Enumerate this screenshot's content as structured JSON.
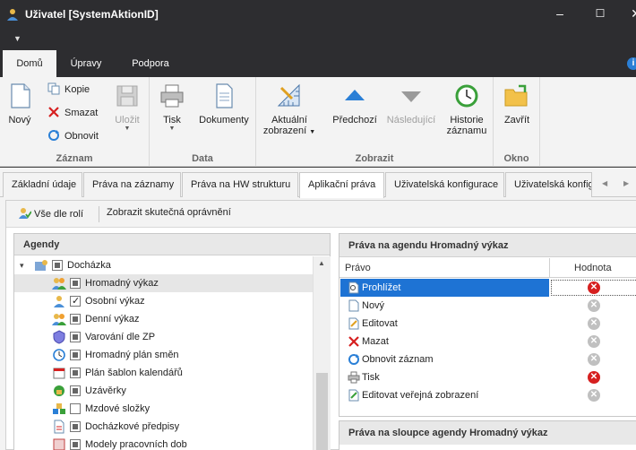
{
  "window": {
    "title": "Uživatel [SystemAktionID]"
  },
  "ribbon_tabs": [
    "Domů",
    "Úpravy",
    "Podpora"
  ],
  "ribbon": {
    "zaznam": {
      "label": "Záznam",
      "novy": "Nový",
      "kopie": "Kopie",
      "smazat": "Smazat",
      "obnovit": "Obnovit",
      "ulozit": "Uložit"
    },
    "data": {
      "label": "Data",
      "tisk": "Tisk",
      "dokumenty": "Dokumenty"
    },
    "zobrazit": {
      "label": "Zobrazit",
      "aktualni": "Aktuální",
      "zobrazeni": "zobrazení",
      "predchozi": "Předchozí",
      "nasledujici": "Následující",
      "historie": "Historie",
      "zaznamu": "záznamu"
    },
    "okno": {
      "label": "Okno",
      "zavrit": "Zavřít"
    }
  },
  "content_tabs": [
    "Základní údaje",
    "Práva na záznamy",
    "Práva na HW strukturu",
    "Aplikační práva",
    "Uživatelská konfigurace",
    "Uživatelská konfig"
  ],
  "toolbar": {
    "vse_dle_roli": "Vše dle rolí",
    "zobrazit_opravneni": "Zobrazit skutečná oprávnění"
  },
  "agendy": {
    "title": "Agendy",
    "items": [
      {
        "label": "Docházka",
        "state": "indeterminate",
        "level": 0,
        "icon": "folder-gear-icon"
      },
      {
        "label": "Hromadný výkaz",
        "state": "indeterminate",
        "level": 1,
        "icon": "users-icon",
        "selected": true
      },
      {
        "label": "Osobní výkaz",
        "state": "checked",
        "level": 1,
        "icon": "user-icon"
      },
      {
        "label": "Denní výkaz",
        "state": "indeterminate",
        "level": 1,
        "icon": "users-icon"
      },
      {
        "label": "Varování dle ZP",
        "state": "indeterminate",
        "level": 1,
        "icon": "shield-icon"
      },
      {
        "label": "Hromadný plán směn",
        "state": "indeterminate",
        "level": 1,
        "icon": "clock-icon"
      },
      {
        "label": "Plán šablon kalendářů",
        "state": "indeterminate",
        "level": 1,
        "icon": "calendar-icon"
      },
      {
        "label": "Uzávěrky",
        "state": "indeterminate",
        "level": 1,
        "icon": "lock-icon"
      },
      {
        "label": "Mzdové složky",
        "state": "unchecked",
        "level": 1,
        "icon": "blocks-icon"
      },
      {
        "label": "Docházkové předpisy",
        "state": "indeterminate",
        "level": 1,
        "icon": "document-icon"
      },
      {
        "label": "Modely pracovních dob",
        "state": "indeterminate",
        "level": 1,
        "icon": "model-icon"
      }
    ]
  },
  "prava": {
    "title": "Práva na agendu Hromadný výkaz",
    "col_pravo": "Právo",
    "col_hodnota": "Hodnota",
    "rows": [
      {
        "label": "Prohlížet",
        "value": "denied",
        "selected": true,
        "icon": "view-icon"
      },
      {
        "label": "Nový",
        "value": "inherited",
        "icon": "new-icon"
      },
      {
        "label": "Editovat",
        "value": "inherited",
        "icon": "edit-icon"
      },
      {
        "label": "Mazat",
        "value": "inherited",
        "icon": "delete-icon"
      },
      {
        "label": "Obnovit záznam",
        "value": "inherited",
        "icon": "refresh-icon"
      },
      {
        "label": "Tisk",
        "value": "denied",
        "icon": "print-icon"
      },
      {
        "label": "Editovat veřejná zobrazení",
        "value": "inherited",
        "icon": "edit-public-icon"
      }
    ]
  },
  "prava2": {
    "title": "Práva na sloupce agendy Hromadný výkaz"
  },
  "colors": {
    "titlebar": "#2d2d30",
    "selection": "#1e73d4",
    "denied": "#d62020",
    "inherited": "#c0c0c0"
  }
}
